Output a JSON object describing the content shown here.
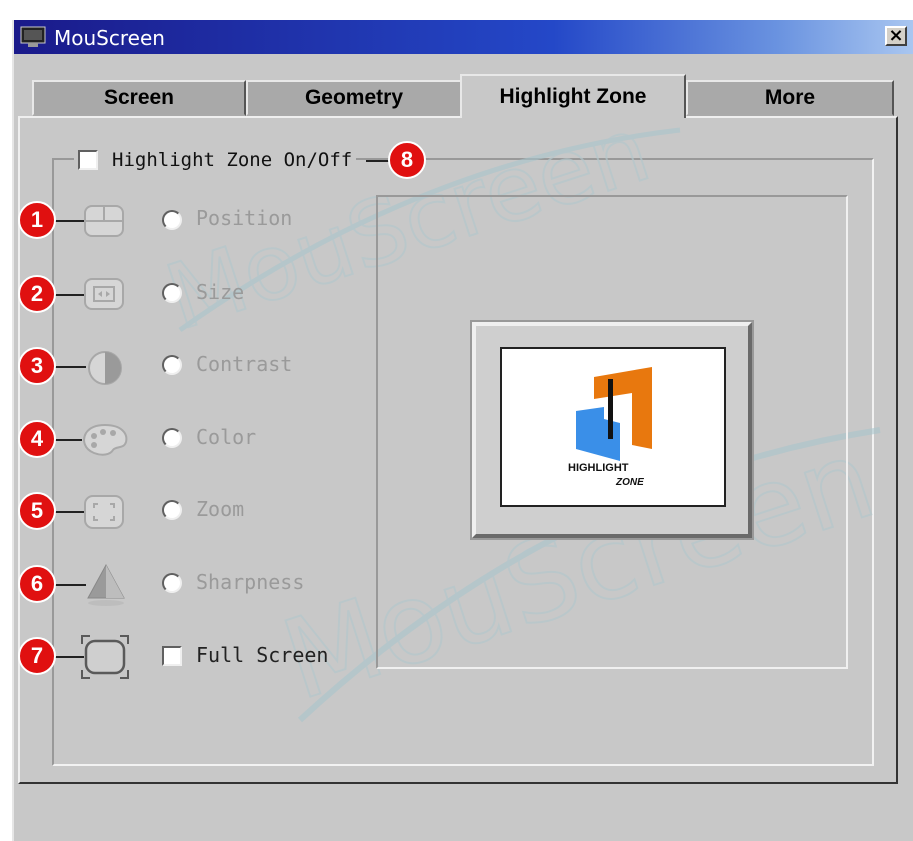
{
  "window": {
    "title": "MouScreen",
    "close_glyph": "×"
  },
  "tabs": [
    {
      "label": "Screen",
      "active": false
    },
    {
      "label": "Geometry",
      "active": false
    },
    {
      "label": "Highlight Zone",
      "active": true
    },
    {
      "label": "More",
      "active": false
    }
  ],
  "highlight_zone": {
    "toggle_label": "Highlight Zone On/Off",
    "toggle_checked": false,
    "toggle_callout": "8",
    "options": [
      {
        "callout": "1",
        "label": "Position",
        "icon": "position-icon",
        "control": "radio",
        "enabled": false
      },
      {
        "callout": "2",
        "label": "Size",
        "icon": "size-icon",
        "control": "radio",
        "enabled": false
      },
      {
        "callout": "3",
        "label": "Contrast",
        "icon": "contrast-icon",
        "control": "radio",
        "enabled": false
      },
      {
        "callout": "4",
        "label": "Color",
        "icon": "color-palette-icon",
        "control": "radio",
        "enabled": false
      },
      {
        "callout": "5",
        "label": "Zoom",
        "icon": "zoom-icon",
        "control": "radio",
        "enabled": false
      },
      {
        "callout": "6",
        "label": "Sharpness",
        "icon": "sharpness-icon",
        "control": "radio",
        "enabled": false
      },
      {
        "callout": "7",
        "label": "Full Screen",
        "icon": "full-screen-icon",
        "control": "checkbox",
        "enabled": true
      }
    ],
    "preview_logo": {
      "line1": "HIGHLIGHT",
      "line2": "ZONE"
    }
  },
  "watermark_text": "MouScreen",
  "colors": {
    "callout": "#e01010",
    "logo_orange": "#e8780e",
    "logo_blue": "#3a8fe8",
    "title_bar_start": "#1a1a8a",
    "title_bar_end": "#a9c6f0"
  }
}
